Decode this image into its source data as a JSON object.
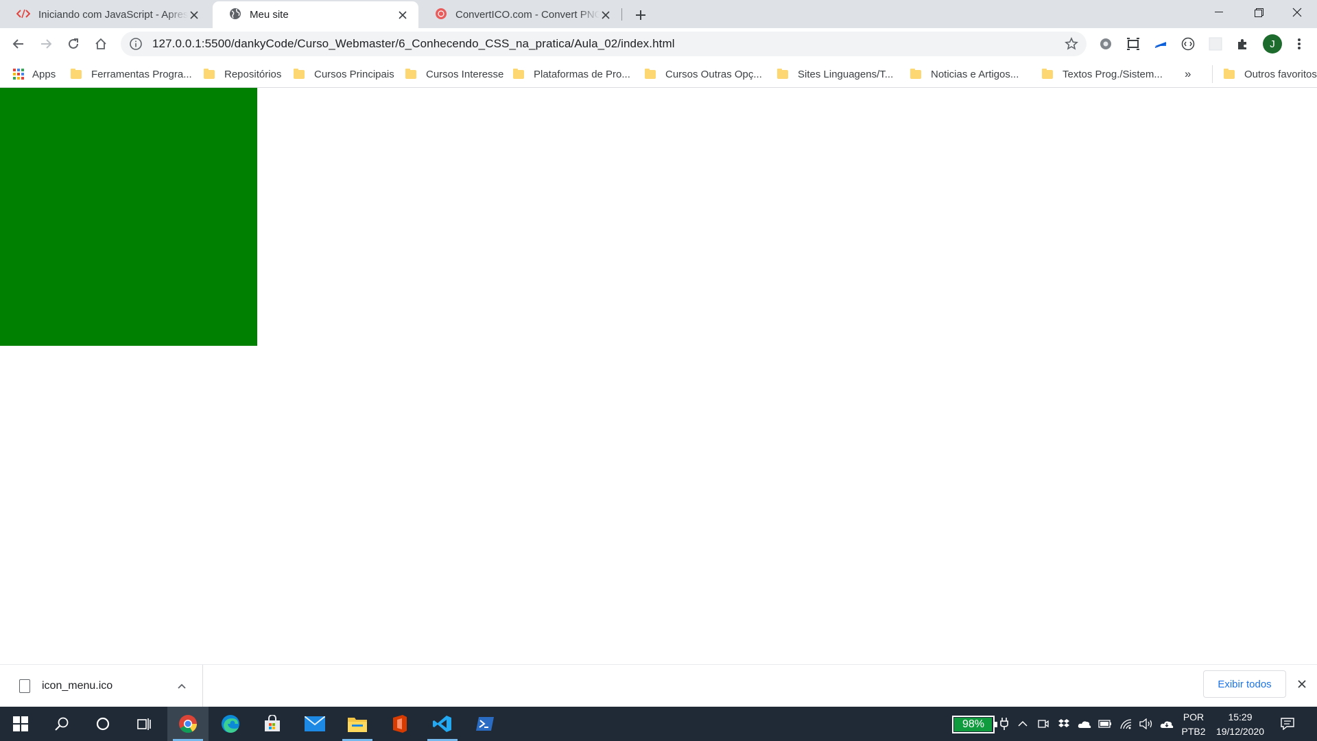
{
  "browser": {
    "tabs": [
      {
        "title": "Iniciando com JavaScript - Apresentação",
        "icon": "code-icon",
        "active": false
      },
      {
        "title": "Meu site",
        "icon": "globe-icon",
        "active": true
      },
      {
        "title": "ConvertICO.com - Convert PNG to ICO",
        "icon": "converticon-icon",
        "active": false
      }
    ],
    "url": "127.0.0.1:5500/dankyCode/Curso_Webmaster/6_Conhecendo_CSS_na_pratica/Aula_02/index.html",
    "profile_initial": "J",
    "bookmarks": {
      "apps_label": "Apps",
      "items": [
        "Ferramentas Progra...",
        "Repositórios",
        "Cursos Principais",
        "Cursos Interesse",
        "Plataformas de Pro...",
        "Cursos Outras Opç...",
        "Sites Linguagens/T...",
        "Noticias e Artigos...",
        "Textos Prog./Sistem..."
      ],
      "overflow_label": "»",
      "other_label": "Outros favoritos"
    }
  },
  "page": {
    "box_color": "#008000"
  },
  "downloads": {
    "file_name": "icon_menu.ico",
    "show_all_label": "Exibir todos"
  },
  "taskbar": {
    "battery_percent": 98,
    "battery_label": "98%",
    "lang_primary": "POR",
    "lang_secondary": "PTB2",
    "time": "15:29",
    "date": "19/12/2020"
  }
}
